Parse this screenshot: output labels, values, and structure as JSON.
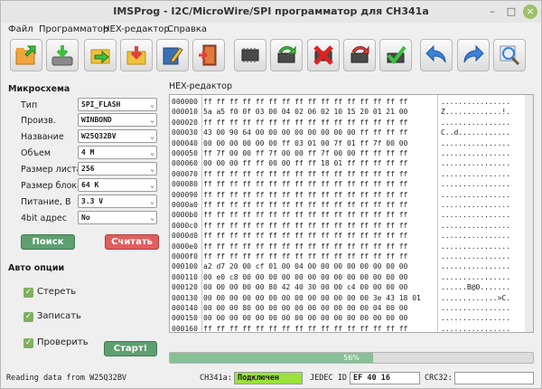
{
  "window": {
    "title": "IMSProg - I2C/MicroWire/SPI программатор для CH341a"
  },
  "menu": [
    "Файл",
    "Программатор",
    "HEX-редактор",
    "Справка"
  ],
  "toolbar_icons": [
    "open-icon",
    "save-icon",
    "load-to-buffer-icon",
    "save-from-buffer-icon",
    "edit-icon",
    "exit-icon",
    "chip-info-icon",
    "read-chip-icon",
    "erase-chip-icon",
    "write-chip-icon",
    "verify-chip-icon",
    "undo-icon",
    "redo-icon",
    "search-chip-icon"
  ],
  "left": {
    "chip_section": "Микросхема",
    "fields": [
      {
        "label": "Тип",
        "value": "SPI_FLASH"
      },
      {
        "label": "Произв.",
        "value": "WINBOND"
      },
      {
        "label": "Название",
        "value": "W25Q32BV"
      },
      {
        "label": "Объем",
        "value": "4 M"
      },
      {
        "label": "Размер листа",
        "value": "256"
      },
      {
        "label": "Размер блока",
        "value": "64 K"
      },
      {
        "label": "Питание, В",
        "value": "3.3 V"
      },
      {
        "label": "4bit адрес",
        "value": "No"
      }
    ],
    "search_button": "Поиск",
    "read_button": "Считать",
    "auto_section": "Авто опции",
    "options": [
      {
        "label": "Стереть",
        "checked": true
      },
      {
        "label": "Записать",
        "checked": true
      },
      {
        "label": "Проверить",
        "checked": true
      }
    ],
    "start_button": "Старт!"
  },
  "hex": {
    "title": "HEX-редактор",
    "rows": [
      {
        "off": "000000",
        "bytes": "ff ff ff ff ff ff ff ff ff ff ff ff ff ff ff ff",
        "ascii": "................"
      },
      {
        "off": "000010",
        "bytes": "5a a5 f0 0f 03 00 04 02 06 02 10 15 20 01 21 00",
        "ascii": "Z.............!."
      },
      {
        "off": "000020",
        "bytes": "ff ff ff ff ff ff ff ff ff ff ff ff ff ff ff ff",
        "ascii": "................"
      },
      {
        "off": "000030",
        "bytes": "43 00 90 64 00 00 00 00 00 00 00 00 ff ff ff ff",
        "ascii": "C..d............"
      },
      {
        "off": "000040",
        "bytes": "00 00 00 00 00 00 ff 03 01 00 7f 01 ff 7f 00 00",
        "ascii": "................"
      },
      {
        "off": "000050",
        "bytes": "ff 7f 00 00 ff 7f 00 00 ff 7f 00 00 ff ff ff ff",
        "ascii": "................"
      },
      {
        "off": "000060",
        "bytes": "00 00 00 ff ff 00 00 ff ff 18 01 ff ff ff ff ff",
        "ascii": "................"
      },
      {
        "off": "000070",
        "bytes": "ff ff ff ff ff ff ff ff ff ff ff ff ff ff ff ff",
        "ascii": "................"
      },
      {
        "off": "000080",
        "bytes": "ff ff ff ff ff ff ff ff ff ff ff ff ff ff ff ff",
        "ascii": "................"
      },
      {
        "off": "000090",
        "bytes": "ff ff ff ff ff ff ff ff ff ff ff ff ff ff ff ff",
        "ascii": "................"
      },
      {
        "off": "0000a0",
        "bytes": "ff ff ff ff ff ff ff ff ff ff ff ff ff ff ff ff",
        "ascii": "................"
      },
      {
        "off": "0000b0",
        "bytes": "ff ff ff ff ff ff ff ff ff ff ff ff ff ff ff ff",
        "ascii": "................"
      },
      {
        "off": "0000c0",
        "bytes": "ff ff ff ff ff ff ff ff ff ff ff ff ff ff ff ff",
        "ascii": "................"
      },
      {
        "off": "0000d0",
        "bytes": "ff ff ff ff ff ff ff ff ff ff ff ff ff ff ff ff",
        "ascii": "................"
      },
      {
        "off": "0000e0",
        "bytes": "ff ff ff ff ff ff ff ff ff ff ff ff ff ff ff ff",
        "ascii": "................"
      },
      {
        "off": "0000f0",
        "bytes": "ff ff ff ff ff ff ff ff ff ff ff ff ff ff ff ff",
        "ascii": "................"
      },
      {
        "off": "000100",
        "bytes": "a2 d7 20 00 cf 01 00 04 00 00 00 00 00 00 00 00",
        "ascii": "................"
      },
      {
        "off": "000110",
        "bytes": "00 e0 c8 00 00 00 00 00 00 00 00 00 00 00 00 00",
        "ascii": "................"
      },
      {
        "off": "000120",
        "bytes": "00 00 00 00 00 80 42 40 30 00 00 c4 00 00 00 00",
        "ascii": "......B@0......."
      },
      {
        "off": "000130",
        "bytes": "00 00 00 00 00 00 00 00 00 00 00 00 00 3e 43 18 01",
        "ascii": ".............>C."
      },
      {
        "off": "000140",
        "bytes": "00 00 00 80 00 00 00 00 00 00 00 00 00 04 00 00",
        "ascii": "................"
      },
      {
        "off": "000150",
        "bytes": "00 00 00 00 00 00 00 00 00 00 00 00 00 00 00 00",
        "ascii": "................"
      },
      {
        "off": "000160",
        "bytes": "ff ff ff ff ff ff ff ff ff ff ff ff ff ff ff ff",
        "ascii": "................"
      }
    ]
  },
  "progress": {
    "value": 56,
    "text": "56%"
  },
  "status": {
    "message": "Reading data from W25Q32BV",
    "ch341_label": "CH341a:",
    "ch341_value": "Подключен",
    "jedec_label": "JEDEC ID",
    "jedec_value": "EF 40 16",
    "crc_label": "CRC32:",
    "crc_value": ""
  },
  "colors": {
    "connected": "#9be23c",
    "progress_fill": "#87c097",
    "accent_green": "#5e9f70",
    "accent_red": "#e05e5e"
  }
}
